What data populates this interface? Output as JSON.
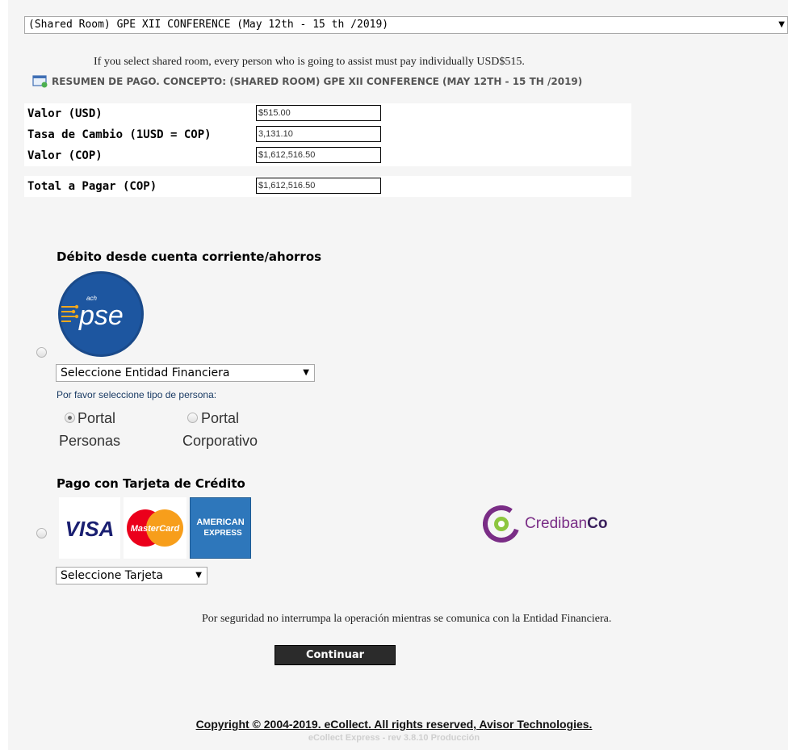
{
  "room_select": {
    "value": "(Shared Room) GPE XII CONFERENCE (May 12th - 15 th /2019)"
  },
  "shared_note": "If you select shared room, every person who is going to assist must pay individually USD$515.",
  "summary": {
    "label": "RESUMEN DE PAGO. CONCEPTO: (SHARED ROOM) GPE XII CONFERENCE (MAY 12TH - 15 TH /2019)"
  },
  "values": [
    {
      "label": "Valor  (USD)",
      "value": "$515.00"
    },
    {
      "label": "Tasa de Cambio (1USD = COP)",
      "value": "3,131.10"
    },
    {
      "label": "Valor  (COP)",
      "value": "$1,612,516.50"
    }
  ],
  "total": {
    "label": "Total a Pagar (COP)",
    "value": "$1,612,516.50"
  },
  "debit": {
    "title": "Débito desde cuenta corriente/ahorros",
    "logo_top": "ach",
    "logo_text": "pse",
    "bank_select": "Seleccione Entidad Financiera",
    "person_type_label": "Por favor seleccione tipo de persona:",
    "portal_personas": [
      "Portal",
      "Personas"
    ],
    "portal_corporativo": [
      "Portal",
      "Corporativo"
    ],
    "selected_portal": "personas"
  },
  "credit": {
    "title": "Pago con Tarjeta de Crédito",
    "visa": "VISA",
    "mastercard": "MasterCard",
    "amex": [
      "AMERICAN",
      "EXPRESS"
    ],
    "card_select": "Seleccione Tarjeta",
    "processor_a": "Crediban",
    "processor_b": "Co"
  },
  "security_note": "Por seguridad no interrumpa la operación mientras se comunica con la Entidad Financiera.",
  "continue_label": "Continuar",
  "footer": {
    "copyright": "Copyright © 2004-2019. eCollect. All rights reserved, Avisor Technologies.",
    "version": "eCollect Express - rev 3.8.10 Producción"
  },
  "colors": {
    "pse_blue": "#1a4a8a",
    "credibanco_purple": "#7a2d86",
    "visa_blue": "#1a1f71",
    "amex_blue": "#2e77bb"
  }
}
